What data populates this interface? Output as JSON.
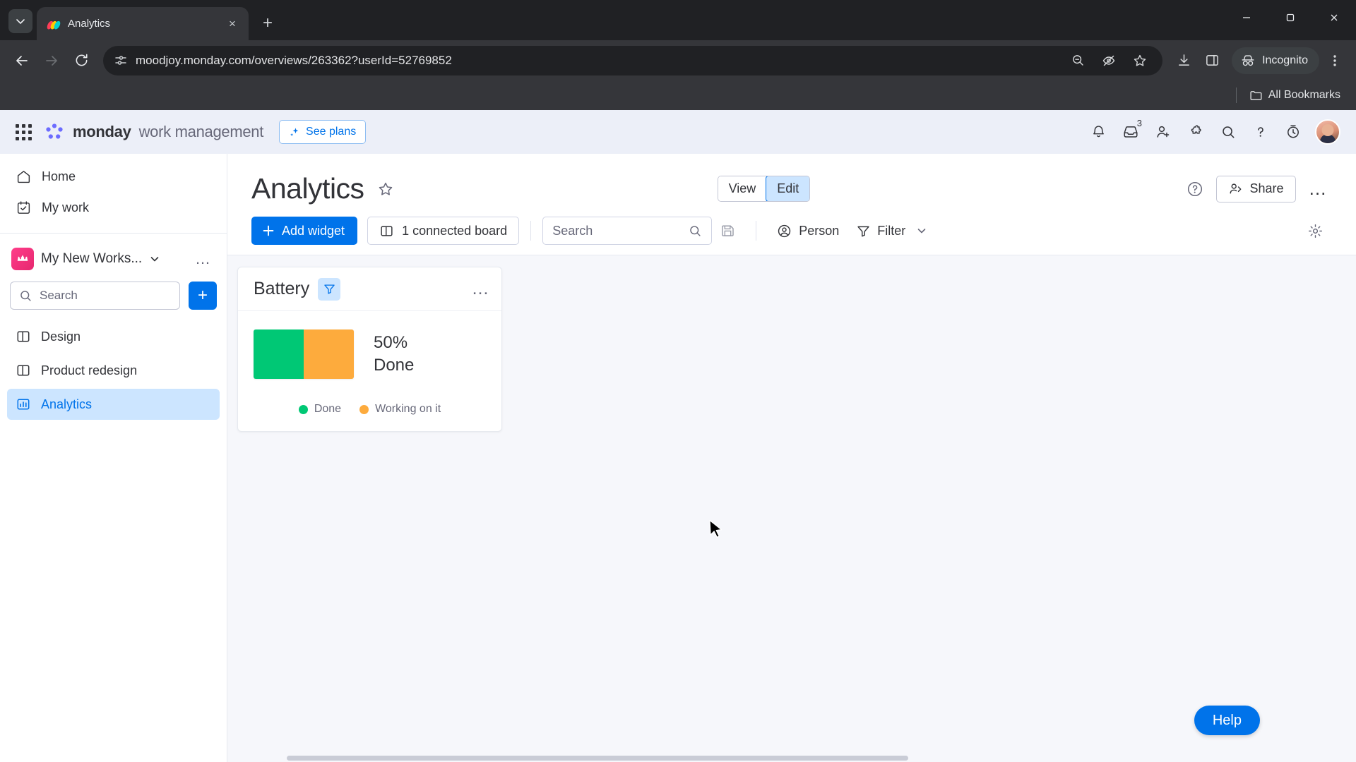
{
  "browser": {
    "tab": {
      "title": "Analytics",
      "favicon": "monday-favicon",
      "close_label": "×"
    },
    "newtab_label": "+",
    "tab_search_icon": "chevron-down-icon",
    "url": "moodjoy.monday.com/overviews/263362?userId=52769852",
    "nav": {
      "back": "back-arrow-icon",
      "forward": "forward-arrow-icon",
      "reload": "reload-icon"
    },
    "omnibox_icons": [
      "site-settings-icon",
      "zoom-out-icon",
      "hide-eye-icon",
      "bookmark-star-icon"
    ],
    "toolbar_icons": [
      "download-icon",
      "side-panel-icon"
    ],
    "incognito_label": "Incognito",
    "menu_icon": "kebab-menu-icon",
    "bookmarks": {
      "all_label": "All Bookmarks",
      "folder_icon": "folder-icon"
    },
    "window": {
      "minimize": "minimize-icon",
      "maximize": "maximize-icon",
      "close": "close-icon"
    }
  },
  "topbar": {
    "waffle_icon": "apps-grid-icon",
    "brand_name": "monday",
    "brand_sub": "work management",
    "see_plans": "See plans",
    "see_plans_icon": "sparkle-icon",
    "actions": [
      {
        "name": "notifications-bell",
        "icon": "bell-icon",
        "badge": ""
      },
      {
        "name": "inbox",
        "icon": "inbox-icon",
        "badge": "3"
      },
      {
        "name": "invite-members",
        "icon": "person-add-icon",
        "badge": ""
      },
      {
        "name": "apps-marketplace",
        "icon": "puzzle-icon",
        "badge": ""
      },
      {
        "name": "search",
        "icon": "search-icon",
        "badge": ""
      },
      {
        "name": "help",
        "icon": "question-mark-icon",
        "badge": ""
      },
      {
        "name": "trial-timer",
        "icon": "clock-icon",
        "badge": ""
      }
    ],
    "avatar": "user-avatar"
  },
  "sidebar": {
    "nav": [
      {
        "label": "Home",
        "icon": "home-icon"
      },
      {
        "label": "My work",
        "icon": "checklist-calendar-icon"
      }
    ],
    "workspace": {
      "name": "My New Works...",
      "avatar_icon": "workspace-crown-icon",
      "chevron": "chevron-down-icon",
      "more": "…"
    },
    "search_placeholder": "Search",
    "add_label": "+",
    "boards": [
      {
        "label": "Design",
        "icon": "board-icon",
        "active": false
      },
      {
        "label": "Product redesign",
        "icon": "board-icon",
        "active": false
      },
      {
        "label": "Analytics",
        "icon": "dashboard-chart-icon",
        "active": true
      }
    ]
  },
  "page": {
    "title": "Analytics",
    "star_icon": "star-outline-icon",
    "view_toggle": {
      "view": "View",
      "edit": "Edit",
      "active": "Edit"
    },
    "help_icon": "question-circle-icon",
    "share_label": "Share",
    "share_icon": "person-share-icon",
    "more_label": "…"
  },
  "toolbar": {
    "add_widget": "Add widget",
    "add_widget_icon": "plus-icon",
    "connected_board": "1 connected board",
    "connected_board_icon": "board-icon",
    "search_placeholder": "Search",
    "search_icon": "search-icon",
    "save_icon": "save-disk-icon",
    "person_label": "Person",
    "person_icon": "person-circle-icon",
    "filter_label": "Filter",
    "filter_icon": "funnel-icon",
    "filter_chevron": "chevron-down-icon",
    "settings_icon": "gear-icon"
  },
  "widget": {
    "title": "Battery",
    "filter_icon": "funnel-icon",
    "more_label": "…",
    "percent": "50%",
    "status": "Done"
  },
  "chart_data": {
    "type": "bar",
    "title": "Battery",
    "categories": [
      "Done",
      "Working on it"
    ],
    "values": [
      50,
      50
    ],
    "colors": [
      "#00c875",
      "#fdab3d"
    ],
    "unit": "%",
    "legend": [
      {
        "label": "Done",
        "color": "#00c875",
        "value": 50
      },
      {
        "label": "Working on it",
        "color": "#fdab3d",
        "value": 50
      }
    ],
    "annotation_percent": "50%",
    "annotation_status": "Done",
    "legend_position": "bottom",
    "grid": false,
    "xlabel": "",
    "ylabel": ""
  },
  "canvas": {
    "help_label": "Help"
  },
  "colors": {
    "accent": "#0073ea",
    "done_green": "#00c875",
    "working_orange": "#fdab3d",
    "selected_blue": "#cce5ff",
    "header_bg": "#eceff8",
    "canvas_bg": "#f6f7fb"
  }
}
